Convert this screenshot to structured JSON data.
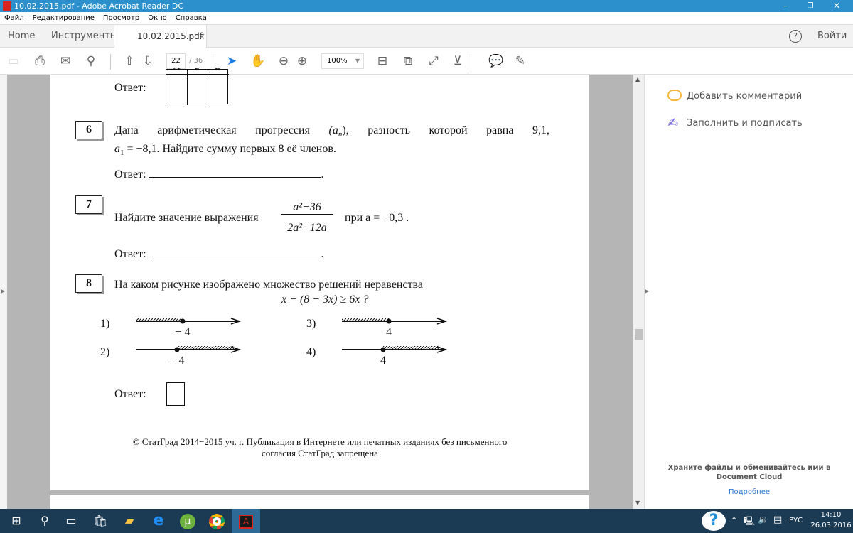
{
  "window": {
    "title": "10.02.2015.pdf - Adobe Acrobat Reader DC",
    "minimize": "–",
    "restore": "❐",
    "close": "✕"
  },
  "menu": [
    "Файл",
    "Редактирование",
    "Просмотр",
    "Окно",
    "Справка"
  ],
  "tabs": {
    "home": "Home",
    "tools": "Инструменты",
    "document": "10.02.2015.pdf",
    "close": "×",
    "help": "?",
    "signin": "Войти"
  },
  "toolbar": {
    "page_current": "22",
    "page_total": "/ 36",
    "zoom": "100%"
  },
  "document": {
    "answer_label": "Ответ:",
    "table_headers": [
      "А",
      "Б",
      "В"
    ],
    "q6": {
      "number": "6",
      "line1_a": "Дана арифметическая прогрессия ",
      "line1_var": "(a",
      "line1_sub": "n",
      "line1_b": "), разность которой равна 9,1,",
      "line2_var": "a",
      "line2_sub": "1",
      "line2_b": " = −8,1. Найдите сумму первых 8 её членов."
    },
    "q7": {
      "number": "7",
      "text_a": "Найдите значение выражения",
      "numerator": "a²−36",
      "denominator": "2a²+12a",
      "text_b": "при a = −0,3 ."
    },
    "q8": {
      "number": "8",
      "text": "На каком рисунке изображено множество решений неравенства",
      "inequality": "x − (8 − 3x) ≥ 6x ?",
      "options": [
        {
          "label": "1)",
          "value": "− 4",
          "shade": "left"
        },
        {
          "label": "2)",
          "value": "− 4",
          "shade": "right"
        },
        {
          "label": "3)",
          "value": "4",
          "shade": "left"
        },
        {
          "label": "4)",
          "value": "4",
          "shade": "right"
        }
      ]
    },
    "footer_line1": "© СтатГрад 2014−2015 уч. г. Публикация в Интернете или печатных изданиях без письменного",
    "footer_line2": "согласия СтатГрад запрещена"
  },
  "right_pane": {
    "comment": "Добавить комментарий",
    "fill_sign": "Заполнить и подписать",
    "cloud_text_1": "Храните файлы и обменивайтесь ими в",
    "cloud_text_2": "Document Cloud",
    "more": "Подробнее"
  },
  "taskbar": {
    "lang": "РУС",
    "time": "14:10",
    "date": "26.03.2016"
  },
  "colors": {
    "titlebar": "#2b90cc",
    "taskbar": "#1b3a53",
    "link": "#2d7ad6",
    "comment_icon": "#f5b83d",
    "sign_icon": "#7b6cf0"
  }
}
